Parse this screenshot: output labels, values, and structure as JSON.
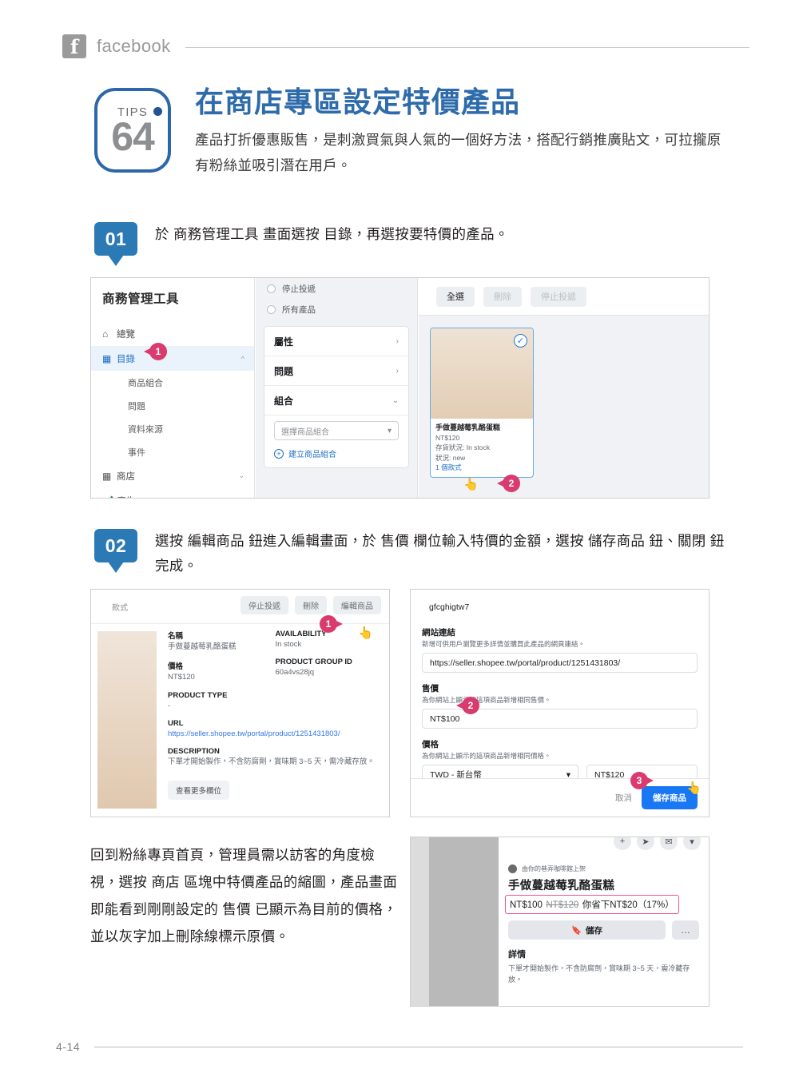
{
  "header": {
    "brand": "facebook",
    "logo_glyph": "f"
  },
  "tip": {
    "label": "TIPS",
    "number": "64",
    "title": "在商店專區設定特價產品",
    "description": "產品打折優惠販售，是刺激買氣與人氣的一個好方法，搭配行銷推廣貼文，可拉攏原有粉絲並吸引潛在用戶。"
  },
  "steps": [
    {
      "num": "01",
      "text": "於 商務管理工具 畫面選按 目錄，再選按要特價的產品。"
    },
    {
      "num": "02",
      "text": "選按 編輯商品 鈕進入編輯畫面，於 售價 欄位輸入特價的金額，選按 儲存商品 鈕、關閉 鈕完成。"
    }
  ],
  "shot1": {
    "sidebar_title": "商務管理工具",
    "nav": [
      {
        "label": "總覽",
        "icon": "home-icon"
      },
      {
        "label": "目錄",
        "icon": "grid-icon",
        "active": true
      },
      {
        "label": "商品組合",
        "sub": true
      },
      {
        "label": "問題",
        "sub": true
      },
      {
        "label": "資料來源",
        "sub": true
      },
      {
        "label": "事件",
        "sub": true
      },
      {
        "label": "商店",
        "icon": "store-icon"
      },
      {
        "label": "廣告",
        "icon": "megaphone-icon"
      }
    ],
    "filters": [
      "停止投遞",
      "所有產品"
    ],
    "sections": [
      {
        "label": "屬性",
        "arrow": "›"
      },
      {
        "label": "問題",
        "arrow": "›"
      },
      {
        "label": "組合",
        "arrow": "⌄"
      }
    ],
    "combo_select_placeholder": "選擇商品組合",
    "create_combo": "建立商品組合",
    "toolbar": [
      {
        "label": "全選",
        "dim": false
      },
      {
        "label": "刪除",
        "dim": true
      },
      {
        "label": "停止投遞",
        "dim": true
      }
    ],
    "product": {
      "name": "手做蔓越莓乳酪蛋糕",
      "price": "NT$120",
      "stock": "存貨狀況: In stock",
      "condition": "狀況: new",
      "variants": "1 個款式"
    },
    "callouts": [
      "1",
      "2"
    ]
  },
  "shot2a": {
    "tab": "款式",
    "buttons": [
      "停止投遞",
      "刪除",
      "編輯商品"
    ],
    "fields": [
      {
        "label": "名稱",
        "value": "手做蔓越莓乳酪蛋糕"
      },
      {
        "label": "AVAILABILITY",
        "value": "In stock"
      },
      {
        "label": "價格",
        "value": "NT$120"
      },
      {
        "label": "PRODUCT GROUP ID",
        "value": "60a4vs28jq"
      },
      {
        "label": "PRODUCT TYPE",
        "value": "-"
      },
      {
        "label": "URL",
        "value": "https://seller.shopee.tw/portal/product/1251431803/",
        "link": true
      },
      {
        "label": "DESCRIPTION",
        "value": "下單才開始製作，不含防腐劑，賞味期 3~5 天，需冷藏存放。"
      }
    ],
    "more_button": "查看更多欄位",
    "callout": "1"
  },
  "shot2b": {
    "top_value": "gfcghigtw7",
    "link_label": "網站連結",
    "link_hint": "新增可供用戶瀏覽更多詳情並購買此產品的網頁連結。",
    "link_value": "https://seller.shopee.tw/portal/product/1251431803/",
    "sale_label": "售價",
    "sale_hint": "為你網站上顯示的這項商品新增相同售價。",
    "sale_value": "NT$100",
    "price_label": "價格",
    "price_hint": "為你網站上顯示的這項商品新增相同價格。",
    "currency_value": "TWD - 新台幣",
    "price_value": "NT$120",
    "cancel_label": "取消",
    "save_label": "儲存商品",
    "callouts": [
      "2",
      "3"
    ]
  },
  "shot3": {
    "byline": "由你的巷弄咖啡館上架",
    "product_name": "手做蔓越莓乳酪蛋糕",
    "price_new": "NT$100",
    "price_old": "NT$120",
    "price_save": "你省下NT$20（17%）",
    "save_button": "儲存",
    "more_button": "…",
    "detail_title": "詳情",
    "detail_text": "下單才開始製作，不含防腐劑，賞味期 3~5 天，需冷藏存放。",
    "icons": [
      "plus-icon",
      "share-icon",
      "message-icon",
      "chevron-down-icon"
    ]
  },
  "bottom_paragraph": "回到粉絲專頁首頁，管理員需以訪客的角度檢視，選按 商店 區塊中特價產品的縮圖，產品畫面即能看到剛剛設定的 售價 已顯示為目前的價格，並以灰字加上刪除線標示原價。",
  "footer": {
    "page_number": "4-14"
  },
  "colors": {
    "accent_blue": "#2e6bab",
    "step_blue": "#2b7ab5",
    "callout_pink": "#d93b6e",
    "fb_blue": "#1877f2"
  }
}
